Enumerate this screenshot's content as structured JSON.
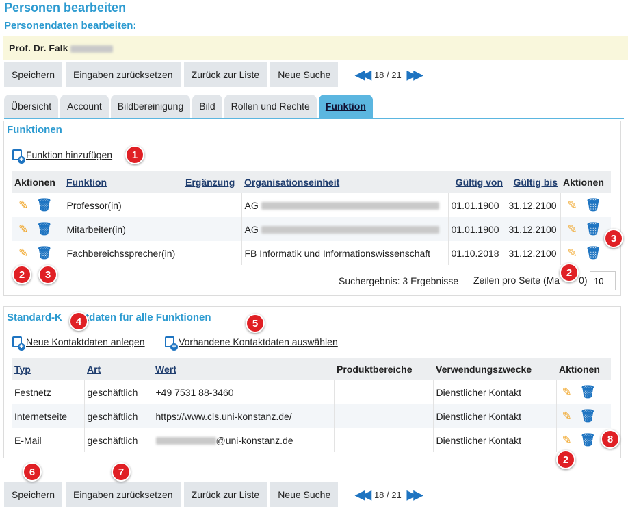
{
  "page": {
    "title": "Personen bearbeiten",
    "subtitle": "Personendaten bearbeiten:",
    "person_name": "Prof. Dr. Falk"
  },
  "toolbar": {
    "save": "Speichern",
    "reset": "Eingaben zurücksetzen",
    "back": "Zurück zur Liste",
    "new_search": "Neue Suche",
    "pager_text": "18 / 21",
    "prev_icon": "double-chevron-left-icon",
    "next_icon": "double-chevron-right-icon"
  },
  "tabs": [
    {
      "label": "Übersicht"
    },
    {
      "label": "Account"
    },
    {
      "label": "Bildbereinigung"
    },
    {
      "label": "Bild"
    },
    {
      "label": "Rollen und Rechte"
    },
    {
      "label": "Funktion",
      "active": true
    }
  ],
  "functions": {
    "title": "Funktionen",
    "add_link": "Funktion hinzufügen",
    "headers": [
      "Aktionen",
      "Funktion",
      "Ergänzung",
      "Organisationseinheit",
      "Gültig von",
      "Gültig bis",
      "Aktionen"
    ],
    "rows": [
      {
        "funktion": "Professor(in)",
        "ergaenzung": "",
        "org": "AG",
        "von": "01.01.1900",
        "bis": "31.12.2100"
      },
      {
        "funktion": "Mitarbeiter(in)",
        "ergaenzung": "",
        "org": "AG",
        "von": "01.01.1900",
        "bis": "31.12.2100"
      },
      {
        "funktion": "Fachbereichssprecher(in)",
        "ergaenzung": "",
        "org": "FB Informatik und Informationswissenschaft",
        "von": "01.10.2018",
        "bis": "31.12.2100"
      }
    ],
    "result_text": "Suchergebnis: 3 Ergebnisse",
    "rows_per_page_label": "Zeilen pro Seite (Ma",
    "rows_per_page_suffix": "0)",
    "rows_per_page_value": "10"
  },
  "contacts": {
    "title_part1": "Standard-K",
    "title_part2": "ktdaten für alle Funktionen",
    "new_link": "Neue Kontaktdaten anlegen",
    "select_link": "Vorhandene Kontaktdaten auswählen",
    "headers": [
      "Typ",
      "Art",
      "Wert",
      "Produktbereiche",
      "Verwendungszwecke",
      "Aktionen"
    ],
    "rows": [
      {
        "typ": "Festnetz",
        "art": "geschäftlich",
        "wert": "+49 7531 88-3460",
        "produkt": "",
        "zweck": "Dienstlicher Kontakt"
      },
      {
        "typ": "Internetseite",
        "art": "geschäftlich",
        "wert": "https://www.cls.uni-konstanz.de/",
        "produkt": "",
        "zweck": "Dienstlicher Kontakt"
      },
      {
        "typ": "E-Mail",
        "art": "geschäftlich",
        "wert": "@uni-konstanz.de",
        "produkt": "",
        "zweck": "Dienstlicher Kontakt"
      }
    ]
  },
  "badges": [
    "1",
    "2",
    "3",
    "2",
    "3",
    "4",
    "5",
    "2",
    "8",
    "6",
    "7"
  ],
  "icons": {
    "edit": "pencil-icon",
    "delete": "trash-icon",
    "add": "add-document-icon"
  },
  "colors": {
    "accent": "#2b9ad0",
    "badge": "#e02025",
    "pencil": "#f0a11c",
    "trash": "#1e74c1"
  }
}
